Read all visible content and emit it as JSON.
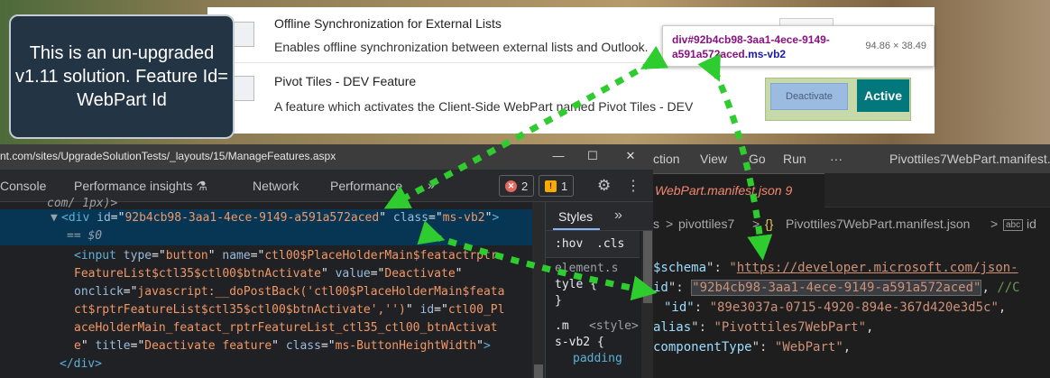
{
  "callout": {
    "text": "This is an un-upgraded v1.11 solution. Feature Id= WebPart Id"
  },
  "sharepoint": {
    "features": [
      {
        "title": "Offline Synchronization for External Lists",
        "description": "Enables offline synchronization between external lists and Outlook."
      },
      {
        "title": "Pivot Tiles - DEV Feature",
        "description": "A feature which activates the Client-Side WebPart named Pivot Tiles - DEV",
        "button_label": "Deactivate",
        "status": "Active"
      }
    ]
  },
  "tooltip": {
    "tag": "div",
    "selector": "#92b4cb98-3aa1-4ece-9149-a591a572aced",
    "class": ".ms-vb2",
    "size": "94.86 × 38.49"
  },
  "devtools": {
    "url": "nt.com/sites/UpgradeSolutionTests/_layouts/15/ManageFeatures.aspx",
    "tabs": [
      "Console",
      "Performance insights",
      "Network",
      "Performance"
    ],
    "errors": "2",
    "warnings": "1",
    "code_lines": [
      {
        "t": "com/ 1px)>"
      },
      {
        "t": "<div id=\"92b4cb98-3aa1-4ece-9149-a591a572aced\" class=\"ms-vb2\">"
      },
      {
        "t": "== $0"
      },
      {
        "t": "<input type=\"button\" name=\"ctl00$PlaceHolderMain$featactrptr"
      },
      {
        "t": "FeatureList$ctl35$ctl00$btnActivate\" value=\"Deactivate\""
      },
      {
        "t": "onclick=\"javascript:__doPostBack('ctl00$PlaceHolderMain$feata"
      },
      {
        "t": "ct$rptrFeatureList$ctl35$ctl00$btnActivate','')\" id=\"ctl00_Pl"
      },
      {
        "t": "aceHolderMain_featact_rptrFeatureList_ctl35_ctl00_btnActivat"
      },
      {
        "t": "e\" title=\"Deactivate feature\" class=\"ms-ButtonHeightWidth\">"
      },
      {
        "t": "</div>"
      }
    ],
    "styles": {
      "tab": "Styles",
      "filters": [
        ":hov",
        ".cls"
      ],
      "lines": [
        "element.s",
        "tyle {",
        "}",
        ".m",
        "<style>",
        "s-vb2 {",
        "padding"
      ]
    }
  },
  "vscode": {
    "menu": [
      "ction",
      "View",
      "Go",
      "Run",
      "···",
      "Pivottiles7WebPart.manifest."
    ],
    "tab_label": "WebPart.manifest.json 9",
    "breadcrumb": [
      "s",
      ">",
      "pivottiles7",
      ">",
      "{}",
      "Pivottiles7WebPart.manifest.json",
      ">",
      "id"
    ],
    "code": {
      "schema_key": "$schema",
      "schema_val": "https://developer.microsoft.com/json-",
      "id_key": "id",
      "id_val": "92b4cb98-3aa1-4ece-9149-a591a572aced",
      "id_comment": "//C",
      "id2_key": "\"id\"",
      "id2_val": "\"89e3037a-0715-4920-894e-367d420e3d5c\"",
      "alias_key": "alias",
      "alias_val": "Pivottiles7WebPart",
      "ctype_key": "componentType",
      "ctype_val": "WebPart"
    }
  },
  "colors": {
    "arrow": "#2ecc2e",
    "active_btn": "#03787c",
    "callout_bg": "#233444"
  }
}
